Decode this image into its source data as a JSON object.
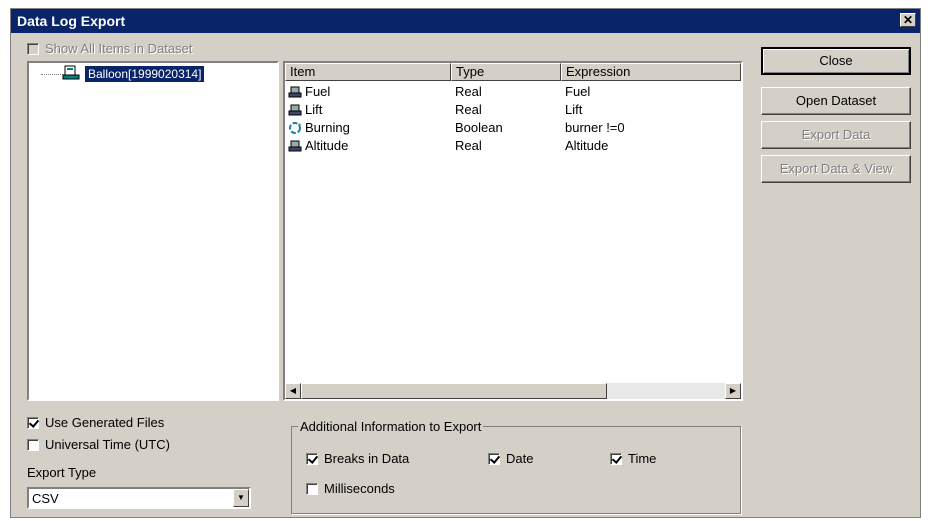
{
  "window": {
    "title": "Data Log Export",
    "close_glyph": "✕"
  },
  "show_all_items": {
    "label": "Show All Items in Dataset",
    "checked": false,
    "enabled": false
  },
  "tree": {
    "root_label": "Balloon[1999020314]",
    "root_icon": "dataset-icon"
  },
  "list": {
    "columns": [
      "Item",
      "Type",
      "Expression"
    ],
    "rows": [
      {
        "icon": "real-item-icon",
        "item": "Fuel",
        "type": "Real",
        "expression": "Fuel"
      },
      {
        "icon": "real-item-icon",
        "item": "Lift",
        "type": "Real",
        "expression": "Lift"
      },
      {
        "icon": "boolean-item-icon",
        "item": "Burning",
        "type": "Boolean",
        "expression": "burner !=0"
      },
      {
        "icon": "real-item-icon",
        "item": "Altitude",
        "type": "Real",
        "expression": "Altitude"
      }
    ]
  },
  "buttons": {
    "close": "Close",
    "open_dataset": "Open Dataset",
    "export_data": "Export Data",
    "export_data_view": "Export Data & View"
  },
  "options": {
    "use_generated_files": {
      "label": "Use Generated Files",
      "checked": true
    },
    "universal_time": {
      "label": "Universal Time (UTC)",
      "checked": false
    }
  },
  "export_type": {
    "label": "Export Type",
    "value": "CSV"
  },
  "additional": {
    "title": "Additional Information to Export",
    "breaks": {
      "label": "Breaks in Data",
      "checked": true
    },
    "date": {
      "label": "Date",
      "checked": true
    },
    "time": {
      "label": "Time",
      "checked": true
    },
    "milliseconds": {
      "label": "Milliseconds",
      "checked": false
    }
  },
  "colors": {
    "titlebar": "#0a246a",
    "face": "#d4d0c8",
    "selection": "#0a246a"
  }
}
